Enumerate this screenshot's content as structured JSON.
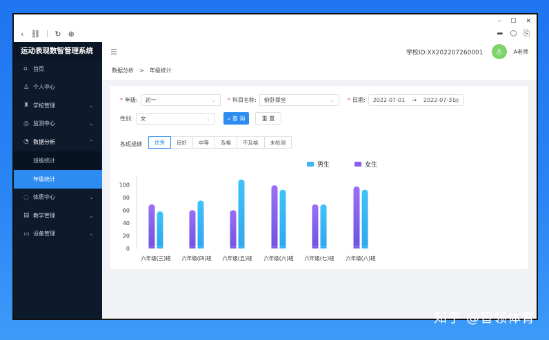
{
  "window": {
    "controls": [
      "–",
      "☐",
      "✕"
    ]
  },
  "browser": {
    "back": "‹",
    "link": "⛓",
    "refresh": "↻",
    "globe": "⊕",
    "share": "➦",
    "cube": "⬡",
    "ext": "⎘"
  },
  "sidebar": {
    "brand": "运动表现数智管理系统",
    "items": [
      {
        "icon": "⌂",
        "label": "首页",
        "chevron": ""
      },
      {
        "icon": "♙",
        "label": "个人中心",
        "chevron": ""
      },
      {
        "icon": "♜",
        "label": "学校管理",
        "chevron": "⌄"
      },
      {
        "icon": "◎",
        "label": "监测中心",
        "chevron": "⌄"
      },
      {
        "icon": "◔",
        "label": "数据分析",
        "chevron": "⌃"
      }
    ],
    "sub_items": [
      {
        "label": "班级统计"
      },
      {
        "label": "年级统计"
      }
    ],
    "items_after": [
      {
        "icon": "◌",
        "label": "体质中心",
        "chevron": "⌄"
      },
      {
        "icon": "▤",
        "label": "教学管理",
        "chevron": "⌄"
      },
      {
        "icon": "▭",
        "label": "设备管理",
        "chevron": "⌄"
      }
    ]
  },
  "topbar": {
    "collapse_icon": "☰",
    "school": "学校ID:XX202207260001",
    "avatar_icon": "♙",
    "user": "A老师"
  },
  "breadcrumb": {
    "parent": "数据分析",
    "sep": ">",
    "current": "年级统计"
  },
  "filters": {
    "grade_label": "年级:",
    "grade_value": "初一",
    "subject_label": "科目名称:",
    "subject_value": "俯卧撑坐",
    "date_label": "日期:",
    "date_start": "2022-07-01",
    "date_sep": "→",
    "date_end": "2022-07-31",
    "gender_label": "性别:",
    "gender_value": "女",
    "search_label": "⌕ 查 询",
    "reset_label": "重 置",
    "required": "*",
    "arrow": "⌄",
    "calendar_icon": "▦"
  },
  "levels": {
    "label": "各班成绩",
    "options": [
      "优秀",
      "良好",
      "中等",
      "及格",
      "不及格",
      "未检测"
    ],
    "selected": "优秀"
  },
  "chart_data": {
    "type": "bar",
    "categories": [
      "六年级(三)班",
      "六年级(四)班",
      "六年级(五)班",
      "六年级(六)班",
      "六年级(七)班",
      "六年级(八)班"
    ],
    "series": [
      {
        "name": "男生",
        "values": [
          69,
          60,
          60,
          99,
          69,
          97
        ],
        "color": "#8a5cf0"
      },
      {
        "name": "女生",
        "values": [
          58,
          75,
          108,
          92,
          69,
          92
        ],
        "color": "#39b8f5"
      }
    ],
    "legend_order": [
      "男生",
      "女生"
    ],
    "legend_colors": {
      "男生": "#39b8f5",
      "女生": "#8a5cf0"
    },
    "yticks": [
      0,
      20,
      40,
      60,
      80,
      100
    ],
    "ytick_labels": [
      "0",
      "20",
      "40",
      "60",
      "80",
      "100"
    ],
    "ylim": [
      0,
      110
    ],
    "xlabel": "",
    "ylabel": "",
    "grid": false,
    "legend_position": "top-right"
  },
  "watermark": "知乎 @智领体育"
}
